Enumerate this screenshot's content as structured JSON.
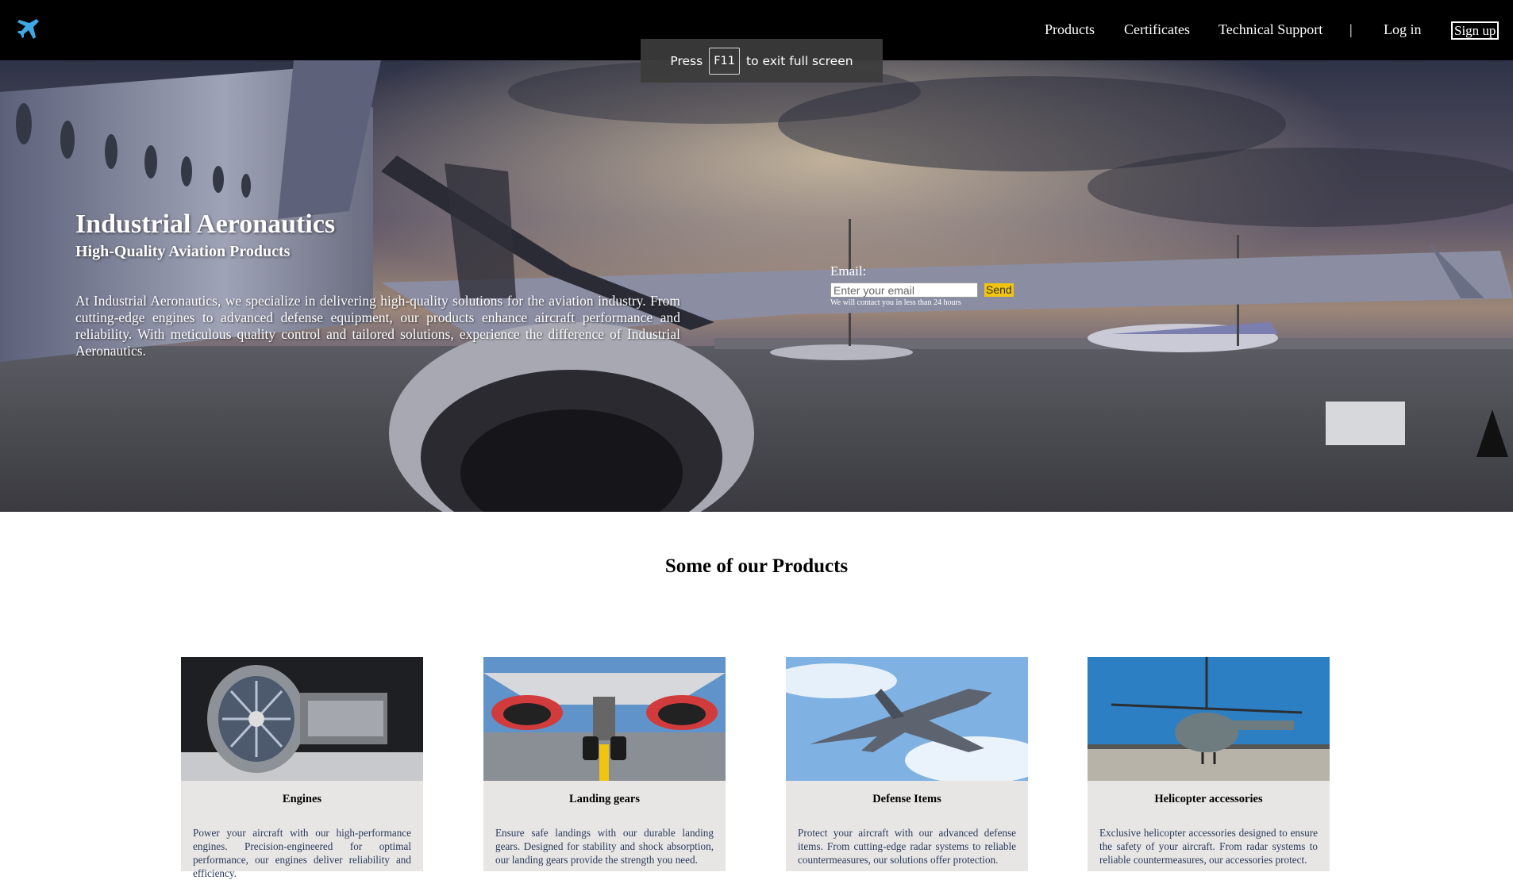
{
  "header": {
    "logo": "airplane-icon",
    "nav": {
      "products": "Products",
      "certificates": "Certificates",
      "technical_support": "Technical Support",
      "separator": "|",
      "login": "Log in",
      "signup": "Sign up"
    }
  },
  "toast": {
    "press": "Press",
    "key": "F11",
    "message": "to exit full screen"
  },
  "hero": {
    "title": "Industrial Aeronautics",
    "subtitle": "High-Quality Aviation Products",
    "description": "At Industrial Aeronautics, we specialize in delivering high-quality solutions for the aviation industry. From cutting-edge engines to advanced defense equipment, our products enhance aircraft performance and reliability. With meticulous quality control and tailored solutions, experience the difference of Industrial Aeronautics.",
    "email_label": "Email:",
    "email_placeholder": "Enter your email",
    "send_label": "Send",
    "email_note": "We will contact you in less than 24 hours"
  },
  "products": {
    "section_title": "Some of our Products",
    "items": [
      {
        "title": "Engines",
        "description": "Power your aircraft with our high-performance engines. Precision-engineered for optimal performance, our engines deliver reliability and efficiency."
      },
      {
        "title": "Landing gears",
        "description": "Ensure safe landings with our durable landing gears. Designed for stability and shock absorption, our landing gears provide the strength you need."
      },
      {
        "title": "Defense Items",
        "description": "Protect your aircraft with our advanced defense items. From cutting-edge radar systems to reliable countermeasures, our solutions offer protection."
      },
      {
        "title": "Helicopter accessories",
        "description": "Exclusive helicopter accessories designed to ensure the safety of your aircraft. From radar systems to reliable countermeasures, our accessories protect."
      }
    ]
  }
}
